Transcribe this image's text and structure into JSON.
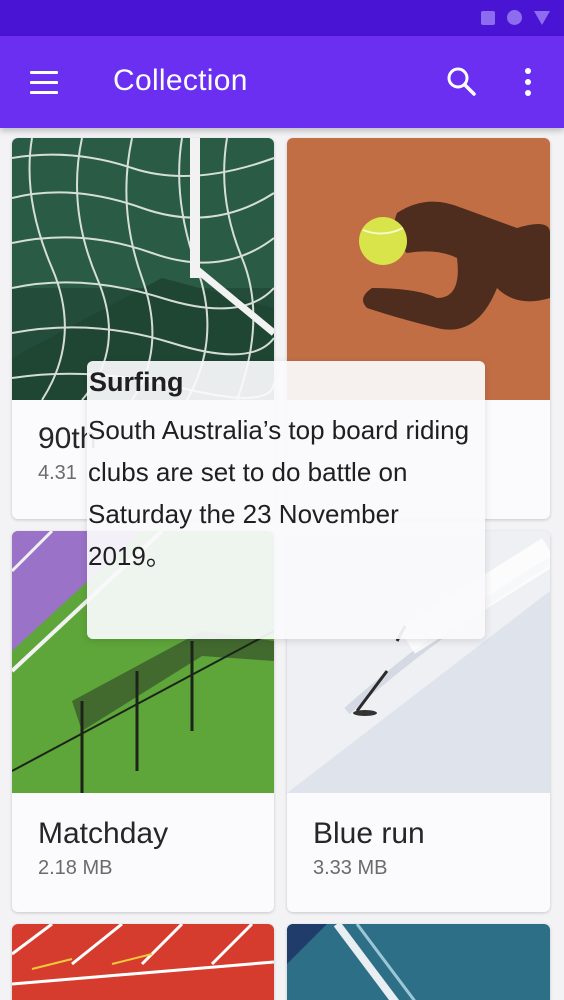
{
  "app_bar": {
    "title": "Collection",
    "color": "#6a2ff0",
    "status_bar_color": "#4a14d4",
    "icons": [
      "menu-icon",
      "search-icon",
      "more-vert-icon"
    ]
  },
  "status_bar": {
    "icons": [
      "square-icon",
      "circle-icon",
      "triangle-icon"
    ]
  },
  "cards": [
    {
      "title": "90th",
      "size": "4.31",
      "image": "soccer-goal-net"
    },
    {
      "title": "",
      "size": "",
      "image": "tennis-ball-clay"
    },
    {
      "title": "Matchday",
      "size": "2.18 MB",
      "image": "tennis-court-fence"
    },
    {
      "title": "Blue run",
      "size": "3.33 MB",
      "image": "snow-skier"
    },
    {
      "title": "",
      "size": "",
      "image": "running-track"
    },
    {
      "title": "",
      "size": "",
      "image": "blue-court"
    }
  ],
  "tooltip": {
    "title": "Surfing",
    "body": "South Australia’s top board riding clubs are set to do battle on Saturday the 23 November 2019。"
  }
}
